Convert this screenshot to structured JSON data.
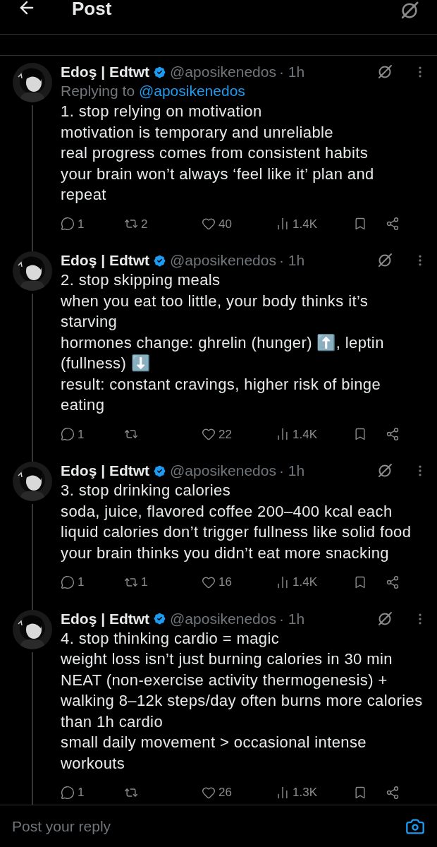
{
  "header": {
    "title": "Post"
  },
  "replies": [
    {
      "name": "Edoş | Edtwt",
      "verified": true,
      "handle": "@aposikenedos",
      "time": "· 1h",
      "replying_to": {
        "label": "Replying to",
        "handle": "@aposikenedos"
      },
      "lines": [
        "1. stop relying on motivation",
        "motivation is temporary and unreliable",
        "real progress comes from consistent habits",
        "your brain won’t always ‘feel like it’ plan and repeat"
      ],
      "replies": "1",
      "reposts": "2",
      "likes": "40",
      "views": "1.4K"
    },
    {
      "name": "Edoş | Edtwt",
      "verified": true,
      "handle": "@aposikenedos",
      "time": "· 1h",
      "lines": [
        "2. stop skipping meals",
        "when you eat too little, your body thinks it’s starving",
        "hormones change: ghrelin (hunger) ⬆️, leptin (fullness) ⬇️",
        "result: constant cravings, higher risk of binge eating"
      ],
      "replies": "1",
      "likes": "22",
      "views": "1.4K"
    },
    {
      "name": "Edoş | Edtwt",
      "verified": true,
      "handle": "@aposikenedos",
      "time": "· 1h",
      "lines": [
        "3. stop drinking calories",
        "soda, juice, flavored coffee 200–400 kcal each",
        "liquid calories don’t trigger fullness like solid food",
        "your brain thinks you didn’t eat more snacking"
      ],
      "replies": "1",
      "reposts": "1",
      "likes": "16",
      "views": "1.4K"
    },
    {
      "name": "Edoş | Edtwt",
      "verified": true,
      "handle": "@aposikenedos",
      "time": "· 1h",
      "lines": [
        "4. stop thinking cardio = magic",
        "weight loss isn’t just burning calories in 30 min",
        "NEAT (non-exercise activity thermogenesis) + walking 8–12k steps/day often burns more calories than 1h cardio",
        "small daily movement > occasional intense workouts"
      ],
      "replies": "1",
      "likes": "26",
      "views": "1.3K"
    }
  ],
  "composer": {
    "placeholder": "Post your reply"
  }
}
